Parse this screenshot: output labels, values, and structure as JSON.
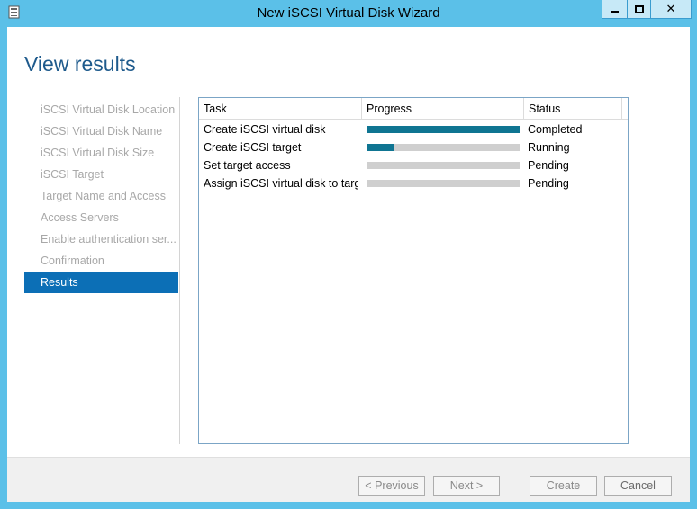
{
  "window": {
    "title": "New iSCSI Virtual Disk Wizard",
    "close_glyph": "✕"
  },
  "page": {
    "title": "View results"
  },
  "nav": {
    "items": [
      {
        "label": "iSCSI Virtual Disk Location",
        "selected": false
      },
      {
        "label": "iSCSI Virtual Disk Name",
        "selected": false
      },
      {
        "label": "iSCSI Virtual Disk Size",
        "selected": false
      },
      {
        "label": "iSCSI Target",
        "selected": false
      },
      {
        "label": "Target Name and Access",
        "selected": false
      },
      {
        "label": "Access Servers",
        "selected": false
      },
      {
        "label": "Enable authentication ser...",
        "selected": false
      },
      {
        "label": "Confirmation",
        "selected": false
      },
      {
        "label": "Results",
        "selected": true
      }
    ]
  },
  "tasks": {
    "columns": {
      "task": "Task",
      "progress": "Progress",
      "status": "Status"
    },
    "rows": [
      {
        "task": "Create iSCSI virtual disk",
        "progress": 1.0,
        "status": "Completed"
      },
      {
        "task": "Create iSCSI target",
        "progress": 0.18,
        "status": "Running"
      },
      {
        "task": "Set target access",
        "progress": 0.0,
        "status": "Pending"
      },
      {
        "task": "Assign iSCSI virtual disk to target",
        "progress": 0.0,
        "status": "Pending"
      }
    ]
  },
  "buttons": {
    "previous": "< Previous",
    "next": "Next >",
    "create": "Create",
    "cancel": "Cancel"
  },
  "colors": {
    "accent": "#0c6fb6",
    "progress_fill": "#0f7592",
    "title_text": "#1e5a8c",
    "window_frame": "#5bc0e8"
  }
}
